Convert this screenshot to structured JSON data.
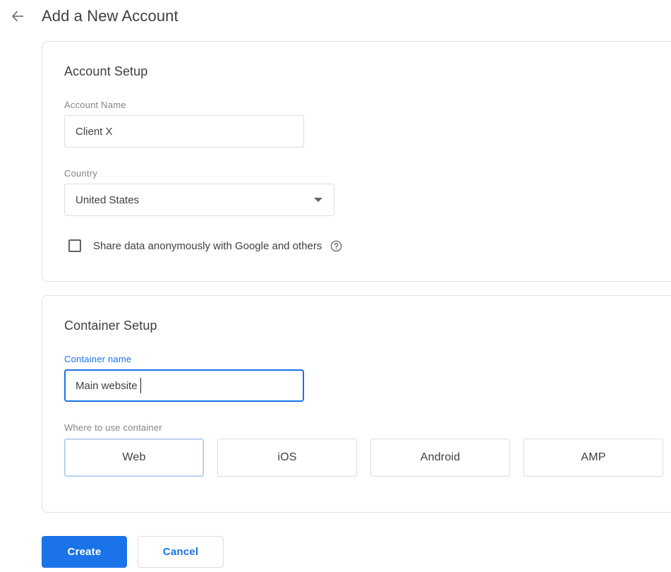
{
  "header": {
    "back_icon": "arrow-back-icon",
    "title": "Add a New Account"
  },
  "account_setup": {
    "title": "Account Setup",
    "account_name": {
      "label": "Account Name",
      "value": "Client X"
    },
    "country": {
      "label": "Country",
      "value": "United States",
      "dropdown_icon": "chevron-down-icon"
    },
    "share_data": {
      "label": "Share data anonymously with Google and others",
      "checked": false,
      "help_icon": "help-circle-icon"
    }
  },
  "container_setup": {
    "title": "Container Setup",
    "container_name": {
      "label": "Container name",
      "value": "Main website",
      "focused": true
    },
    "target_platform": {
      "label": "Where to use container",
      "options": [
        {
          "label": "Web",
          "selected": true
        },
        {
          "label": "iOS",
          "selected": false
        },
        {
          "label": "Android",
          "selected": false
        },
        {
          "label": "AMP",
          "selected": false
        }
      ]
    }
  },
  "actions": {
    "create_label": "Create",
    "cancel_label": "Cancel"
  },
  "colors": {
    "accent": "#1a73e8",
    "text_primary": "#3c4043",
    "text_secondary": "#80868b",
    "border": "#dadce0",
    "card_border": "#e0e0e0",
    "tile_selected_border": "#a9c3e8"
  }
}
